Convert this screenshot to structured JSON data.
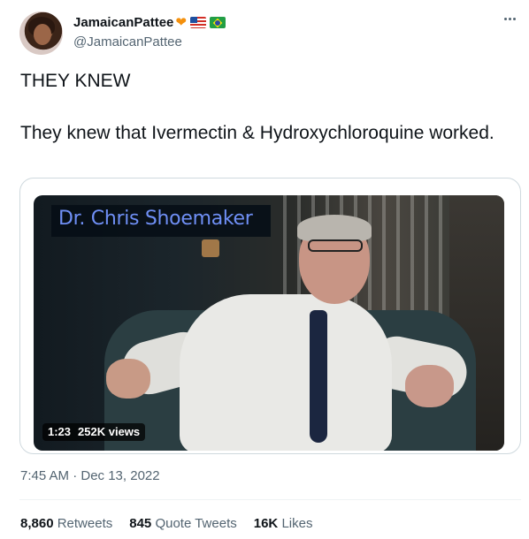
{
  "author": {
    "display_name": "JamaicanPattee",
    "handle": "@JamaicanPattee",
    "emoji": [
      "orange-heart",
      "flag-us",
      "flag-br"
    ]
  },
  "tweet": {
    "line1": "THEY KNEW",
    "line2": "They knew that Ivermectin & Hydroxychloroquine worked."
  },
  "media": {
    "caption": "Dr. Chris Shoemaker",
    "duration": "1:23",
    "views": "252K views"
  },
  "timestamp": "7:45 AM · Dec 13, 2022",
  "stats": [
    {
      "value": "8,860",
      "label": "Retweets"
    },
    {
      "value": "845",
      "label": "Quote Tweets"
    },
    {
      "value": "16K",
      "label": "Likes"
    }
  ],
  "colors": {
    "text_primary": "#0f1419",
    "text_secondary": "#536471",
    "border": "#cfd9de",
    "caption_blue": "#6f8ff5"
  }
}
